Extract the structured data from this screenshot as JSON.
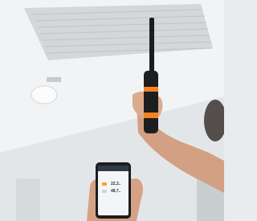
{
  "scene": {
    "description_free": true,
    "phone": {
      "readings": [
        "22,3..",
        "48,7.."
      ]
    },
    "colors": {
      "probe_accent": "#f58220",
      "probe_body": "#1b1c1e",
      "ceiling": "#eef0f1",
      "vent": "#c9cdd0",
      "skin": "#d9a487"
    }
  }
}
